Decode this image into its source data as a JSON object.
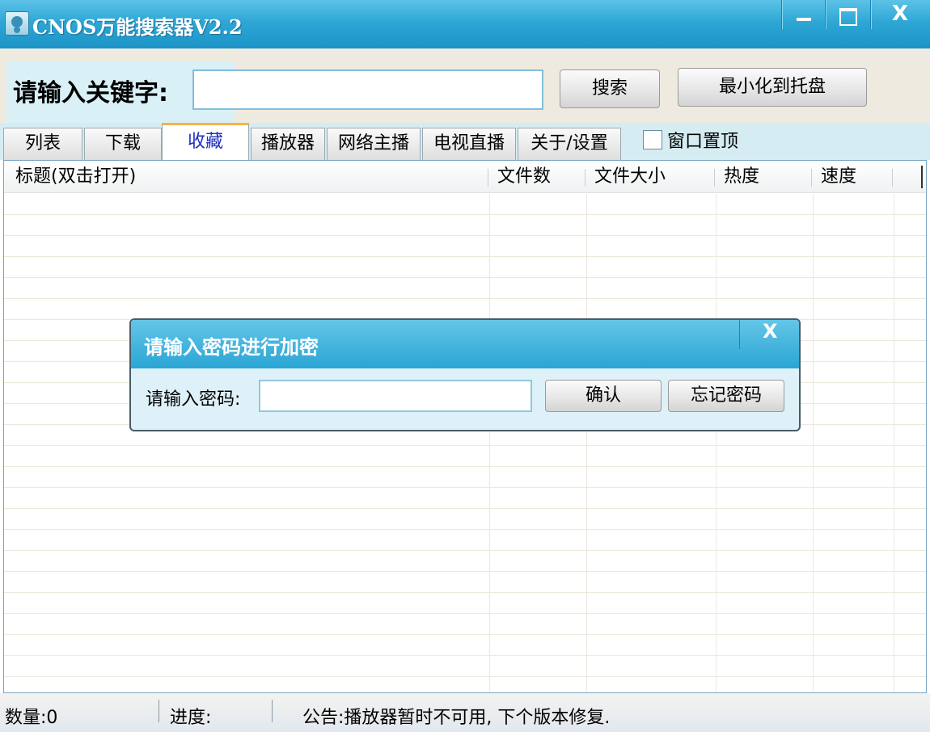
{
  "window": {
    "title": "CNOS万能搜索器V2.2",
    "controls": {
      "minimize": "minimize",
      "maximize": "maximize",
      "close": "x"
    },
    "close_glyph": "X"
  },
  "search": {
    "label": "请输入关键字:",
    "value": "",
    "search_button": "搜索",
    "tray_button": "最小化到托盘"
  },
  "tabs": [
    {
      "label": "列表",
      "active": false
    },
    {
      "label": "下载",
      "active": false
    },
    {
      "label": "收藏",
      "active": true
    },
    {
      "label": "播放器",
      "active": false
    },
    {
      "label": "网络主播",
      "active": false
    },
    {
      "label": "电视直播",
      "active": false
    },
    {
      "label": "关于/设置",
      "active": false
    }
  ],
  "topmost": {
    "label": "窗口置顶",
    "checked": false
  },
  "list": {
    "columns": [
      "标题(双击打开)",
      "文件数",
      "文件大小",
      "热度",
      "速度"
    ],
    "rows": []
  },
  "dialog": {
    "title": "请输入密码进行加密",
    "close_glyph": "X",
    "password_label": "请输入密码:",
    "password_value": "",
    "confirm_button": "确认",
    "forgot_button": "忘记密码"
  },
  "status": {
    "count": "数量:0",
    "progress": "进度:",
    "notice": "公告:播放器暂时不可用, 下个版本修复."
  },
  "colors": {
    "titlebar": "#2ea7d6",
    "active_tab_text": "#1d2fbf",
    "active_tab_accent": "#f7b24a",
    "grid_line": "#ece8dc"
  }
}
